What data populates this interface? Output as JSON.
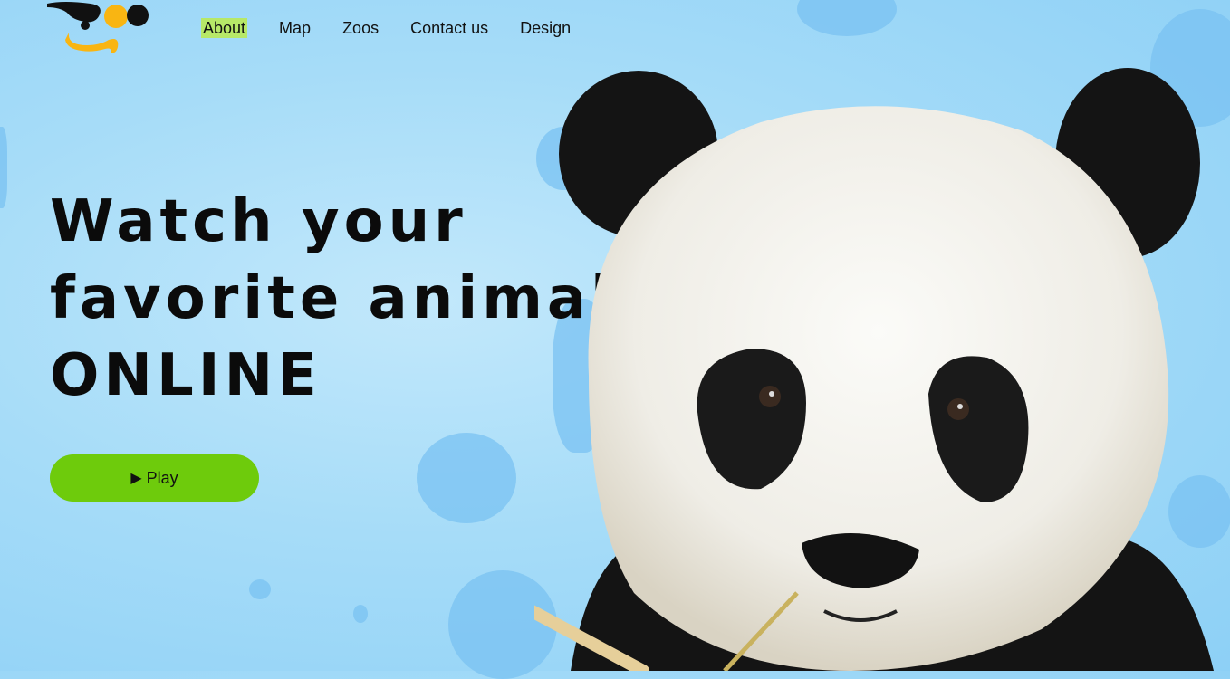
{
  "nav": {
    "items": [
      {
        "label": "About",
        "active": true
      },
      {
        "label": "Map",
        "active": false
      },
      {
        "label": "Zoos",
        "active": false
      },
      {
        "label": "Contact us",
        "active": false
      },
      {
        "label": "Design",
        "active": false
      }
    ]
  },
  "hero": {
    "headline_line1": "Watch your",
    "headline_line2": "favorite animal",
    "headline_line3": "ONLINE",
    "play_label": "Play",
    "play_icon": "play-triangle-icon"
  },
  "colors": {
    "background": "#a6dcf8",
    "play_button": "#6ecb0c",
    "active_nav_highlight": "#b7e868",
    "logo_yellow": "#f9b512",
    "logo_black": "#111111"
  }
}
